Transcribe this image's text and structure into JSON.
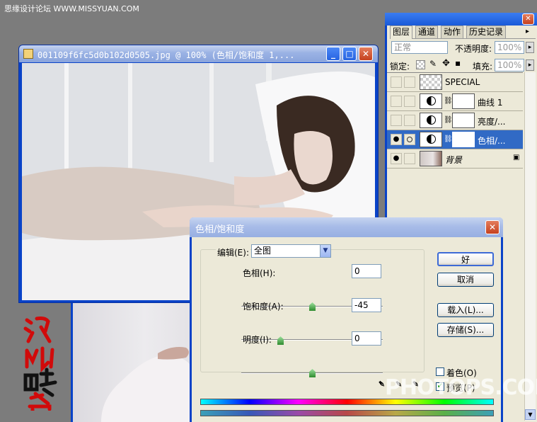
{
  "watermark_top": "思缘设计论坛 WWW.MISSYUAN.COM",
  "watermark_bottom": "PHOTOPS.COM",
  "signature_text": "沈阳酷客",
  "image_window": {
    "title": "001109f6fc5d0b102d0505.jpg @ 100% (色相/饱和度 1,...",
    "minimize": "_",
    "maximize": "□",
    "close": "✕"
  },
  "layers_panel": {
    "tabs": [
      "图层",
      "通道",
      "动作",
      "历史记录"
    ],
    "blend_mode": "正常",
    "opacity_label": "不透明度:",
    "opacity_value": "100%",
    "lock_label": "锁定:",
    "fill_label": "填充:",
    "fill_value": "100%",
    "close": "✕",
    "layers": [
      {
        "name": "SPECIAL",
        "visible": false,
        "selected": false
      },
      {
        "name": "曲线 1",
        "visible": false,
        "selected": false
      },
      {
        "name": "亮度/...",
        "visible": false,
        "selected": false
      },
      {
        "name": "色相/...",
        "visible": true,
        "selected": true
      },
      {
        "name": "背景",
        "visible": true,
        "selected": false
      }
    ]
  },
  "dialog": {
    "title": "色相/饱和度",
    "close": "✕",
    "edit_label": "编辑(E):",
    "edit_value": "全图",
    "hue_label": "色相(H):",
    "hue_value": "0",
    "saturation_label": "饱和度(A):",
    "saturation_value": "-45",
    "lightness_label": "明度(I):",
    "lightness_value": "0",
    "ok": "好",
    "cancel": "取消",
    "load": "载入(L)...",
    "save": "存储(S)...",
    "colorize_label": "着色(O)",
    "colorize_checked": false,
    "preview_label": "预览(P)",
    "preview_checked": true,
    "hue_slider": 0.5,
    "saturation_slider": 0.275,
    "lightness_slider": 0.5
  },
  "colors": {
    "accent": "#316ac5",
    "title_blue": "#0a43c8",
    "panel_bg": "#ece9d8"
  }
}
